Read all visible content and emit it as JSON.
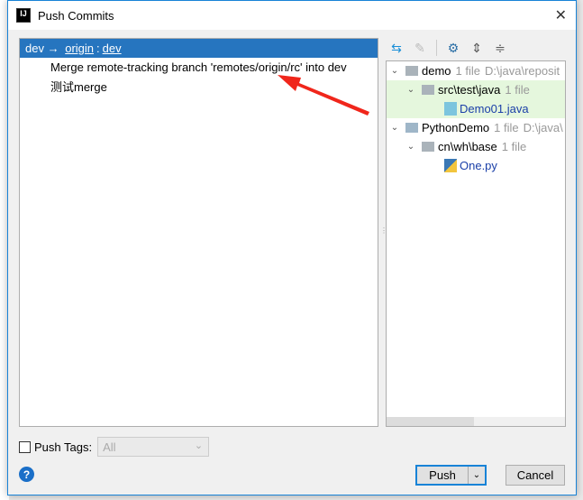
{
  "window": {
    "title": "Push Commits",
    "app_icon": "IJ"
  },
  "branch": {
    "local": "dev",
    "arrow": "→",
    "remote": "origin",
    "sep": ":",
    "remote_branch": "dev"
  },
  "commits": [
    "Merge remote-tracking branch 'remotes/origin/rc' into dev",
    "测试merge"
  ],
  "tree": [
    {
      "name": "demo",
      "count": "1 file",
      "path": "D:\\java\\reposit"
    },
    {
      "name": "src\\test\\java",
      "count": "1 file"
    },
    {
      "name": "Demo01.java"
    },
    {
      "name": "PythonDemo",
      "count": "1 file",
      "path": "D:\\java\\"
    },
    {
      "name": "cn\\wh\\base",
      "count": "1 file"
    },
    {
      "name": "One.py"
    }
  ],
  "footer": {
    "push_tags_label": "Push Tags:",
    "tags_value": "All",
    "push_label": "Push",
    "cancel_label": "Cancel",
    "help": "?"
  },
  "colors": {
    "selection": "#2675bf",
    "accent": "#1883d7",
    "arrow": "#f0261b"
  }
}
